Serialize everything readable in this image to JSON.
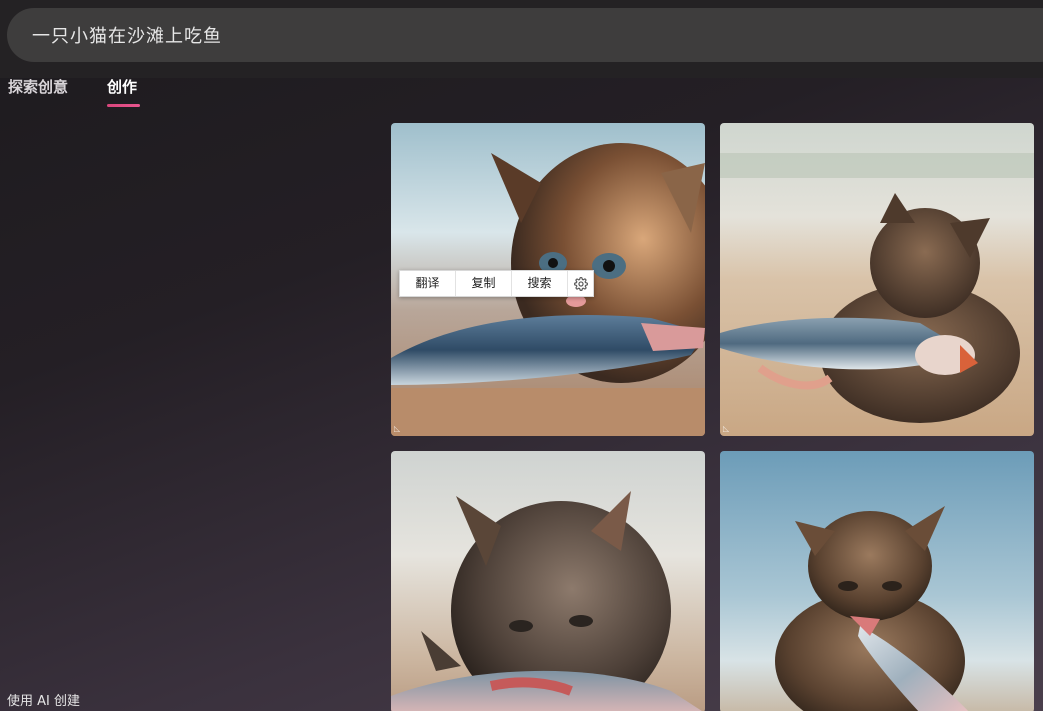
{
  "search": {
    "query": "一只小猫在沙滩上吃鱼"
  },
  "tabs": [
    {
      "label": "探索创意",
      "active": false
    },
    {
      "label": "创作",
      "active": true
    }
  ],
  "context_menu": {
    "items": [
      {
        "label": "翻译"
      },
      {
        "label": "复制"
      },
      {
        "label": "搜索"
      }
    ],
    "settings_icon": "gear-icon"
  },
  "images": [
    {
      "subject": "kitten-eating-fish"
    },
    {
      "subject": "kitten-eating-fish"
    },
    {
      "subject": "kitten-eating-fish"
    },
    {
      "subject": "kitten-eating-fish"
    }
  ],
  "footer": {
    "label": "使用 AI 创建"
  },
  "colors": {
    "tab_underline": "#d9467c",
    "search_bg": "#3e3d3d"
  }
}
